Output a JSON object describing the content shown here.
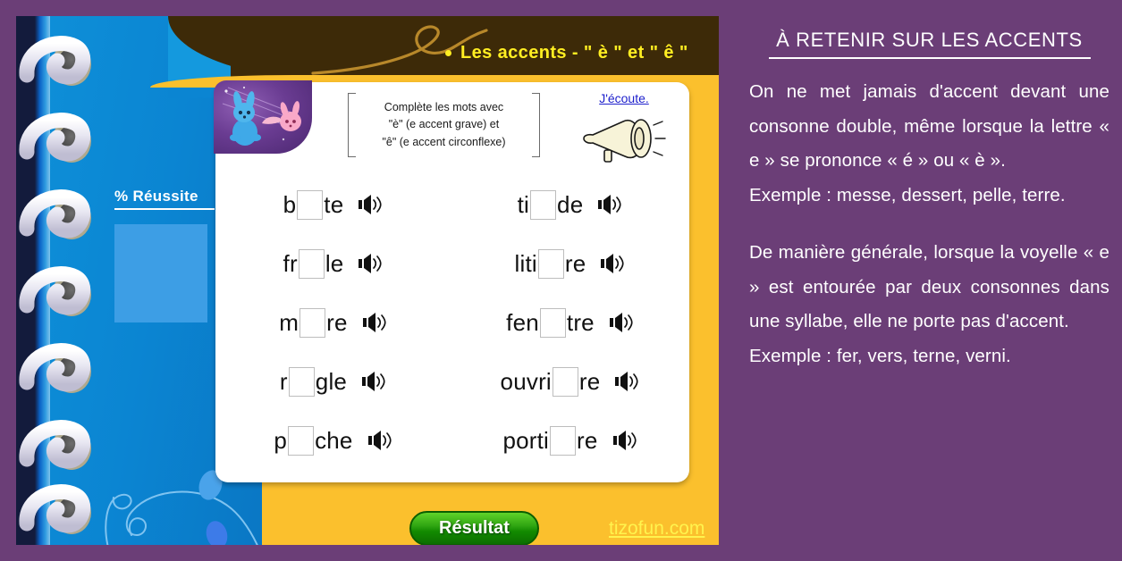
{
  "colors": {
    "background_purple": "#6B3E77",
    "banner_brown": "#3D2A08",
    "title_yellow": "#FFEE22",
    "page_blue": "#0B85D2",
    "bottom_yellow": "#FBC02D",
    "result_green": "#2FA512",
    "link_blue": "#1E20CC",
    "site_link_yellow": "#FFF34D"
  },
  "header": {
    "bullet_icon": "bullet-dot",
    "lesson_title": "Les accents - \" è \" et \" ê \""
  },
  "sidebar": {
    "score_label": "% Réussite",
    "score_value": ""
  },
  "card": {
    "mascot_icon": "rabbit-mascot",
    "instruction": {
      "line1": "Complète les mots avec",
      "line2": "\"è\" (e accent grave) et",
      "line3": "\"ê\" (e accent circonflexe)"
    },
    "listen": {
      "label": "J'écoute.",
      "icon": "megaphone-icon"
    },
    "speaker_icon": "speaker-icon",
    "words": [
      {
        "id": "word-1",
        "column": "left",
        "prefix": "b",
        "blank": "",
        "suffix": "te"
      },
      {
        "id": "word-2",
        "column": "right",
        "prefix": "ti",
        "blank": "",
        "suffix": "de"
      },
      {
        "id": "word-3",
        "column": "left",
        "prefix": "fr",
        "blank": "",
        "suffix": "le"
      },
      {
        "id": "word-4",
        "column": "right",
        "prefix": "liti",
        "blank": "",
        "suffix": "re"
      },
      {
        "id": "word-5",
        "column": "left",
        "prefix": "m",
        "blank": "",
        "suffix": "re"
      },
      {
        "id": "word-6",
        "column": "right",
        "prefix": "fen",
        "blank": "",
        "suffix": "tre"
      },
      {
        "id": "word-7",
        "column": "left",
        "prefix": "r",
        "blank": "",
        "suffix": "gle"
      },
      {
        "id": "word-8",
        "column": "right",
        "prefix": "ouvri",
        "blank": "",
        "suffix": "re"
      },
      {
        "id": "word-9",
        "column": "left",
        "prefix": "p",
        "blank": "",
        "suffix": "che"
      },
      {
        "id": "word-10",
        "column": "right",
        "prefix": "porti",
        "blank": "",
        "suffix": "re"
      }
    ]
  },
  "footer": {
    "result_button": "Résultat",
    "site_link": "tizofun.com"
  },
  "lesson_panel": {
    "title": "À RETENIR SUR LES ACCENTS",
    "paragraph1": "On ne met jamais d'accent devant une consonne double, même lorsque la lettre « e » se prononce « é » ou « è ».",
    "example1": "Exemple : messe, dessert, pelle, terre.",
    "paragraph2": "De manière générale, lorsque la voyelle « e » est entourée par deux consonnes dans une syllabe, elle ne porte pas d'accent.",
    "example2": "Exemple : fer, vers, terne, verni."
  }
}
